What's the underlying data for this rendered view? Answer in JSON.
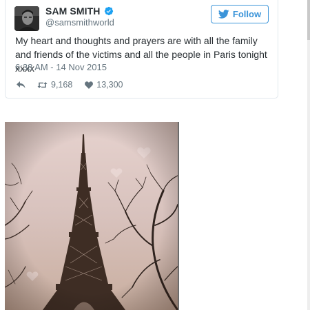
{
  "tweet": {
    "author_name": "SAM SMITH",
    "author_handle": "@samsmithworld",
    "follow_label": "Follow",
    "text": "My heart and thoughts and prayers are with all the family and friends of the victims and all the people in Paris tonight xxxx",
    "timestamp": "6:38 AM - 14 Nov 2015",
    "retweet_count": "9,168",
    "like_count": "13,300"
  },
  "icons": {
    "verified": "verified-icon",
    "follow": "twitter-bird-icon",
    "reply": "reply-icon",
    "retweet": "retweet-icon",
    "like": "heart-icon"
  },
  "colors": {
    "twitter_blue": "#3b94d9",
    "verified_blue": "#1da1f2",
    "muted_text": "#66757f",
    "body_text": "#292f33",
    "card_border": "#e1e8ed"
  }
}
